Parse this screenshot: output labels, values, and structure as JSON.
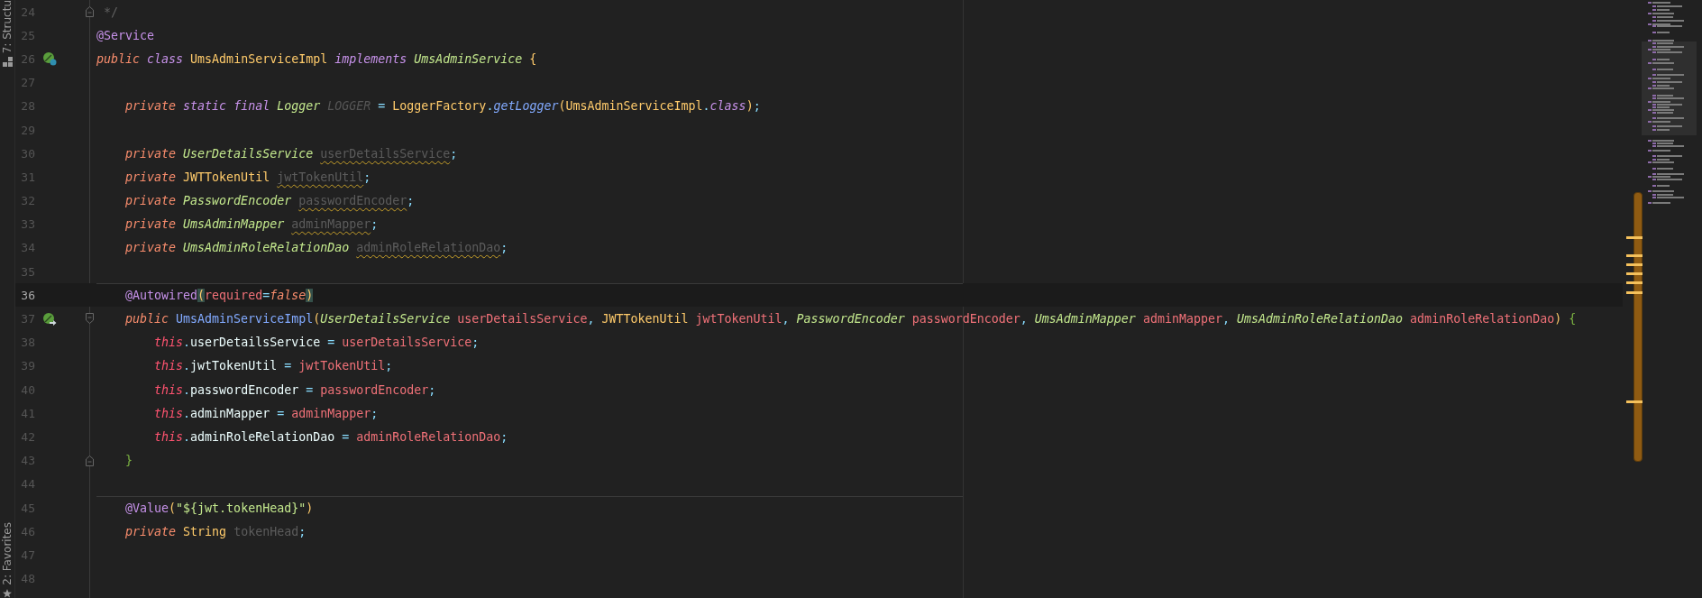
{
  "tool_windows_top": [
    {
      "label": "7: Structu"
    }
  ],
  "tool_windows_bottom": [
    {
      "label": "2: Favorites"
    }
  ],
  "editor": {
    "lines": [
      {
        "number": "24",
        "current": false,
        "separator": false,
        "fold": {
          "kind": "end"
        },
        "tokens": [
          {
            "text": " */",
            "kind": "comment"
          }
        ]
      },
      {
        "number": "25",
        "current": false,
        "separator": false,
        "tokens": [
          {
            "text": "@Service",
            "kind": "annot"
          }
        ]
      },
      {
        "number": "26",
        "current": false,
        "separator": false,
        "marker": {
          "kind": "bean-class"
        },
        "tokens": [
          {
            "text": "public ",
            "kind": "kw"
          },
          {
            "text": "class ",
            "kind": "kw2"
          },
          {
            "text": "UmsAdminServiceImpl ",
            "kind": "cls"
          },
          {
            "text": "implements ",
            "kind": "kw2"
          },
          {
            "text": "UmsAdminService ",
            "kind": "type"
          },
          {
            "text": "{",
            "kind": "paren"
          }
        ]
      },
      {
        "number": "27",
        "current": false,
        "separator": false
      },
      {
        "number": "28",
        "current": false,
        "separator": false,
        "tokens": [
          {
            "text": "    private ",
            "kind": "kw"
          },
          {
            "text": "static ",
            "kind": "kw2"
          },
          {
            "text": "final ",
            "kind": "kw2"
          },
          {
            "text": "Logger ",
            "kind": "type"
          },
          {
            "text": "LOGGER",
            "kind": "const-unused"
          },
          {
            "text": " = ",
            "kind": "punct"
          },
          {
            "text": "LoggerFactory",
            "kind": "cls"
          },
          {
            "text": ".",
            "kind": "punct"
          },
          {
            "text": "getLogger",
            "kind": "method"
          },
          {
            "text": "(",
            "kind": "paren"
          },
          {
            "text": "UmsAdminServiceImpl",
            "kind": "cls"
          },
          {
            "text": ".",
            "kind": "punct"
          },
          {
            "text": "class",
            "kind": "kw2"
          },
          {
            "text": ")",
            "kind": "paren"
          },
          {
            "text": ";",
            "kind": "punct"
          }
        ]
      },
      {
        "number": "29",
        "current": false,
        "separator": false
      },
      {
        "number": "30",
        "current": false,
        "separator": false,
        "tokens": [
          {
            "text": "    private ",
            "kind": "kw"
          },
          {
            "text": "UserDetailsService ",
            "kind": "type"
          },
          {
            "text": "userDetailsService",
            "kind": "unused-warn"
          },
          {
            "text": ";",
            "kind": "punct"
          }
        ]
      },
      {
        "number": "31",
        "current": false,
        "separator": false,
        "tokens": [
          {
            "text": "    private ",
            "kind": "kw"
          },
          {
            "text": "JWTTokenUtil ",
            "kind": "cls"
          },
          {
            "text": "jwtTokenUtil",
            "kind": "unused-warn"
          },
          {
            "text": ";",
            "kind": "punct"
          }
        ]
      },
      {
        "number": "32",
        "current": false,
        "separator": false,
        "tokens": [
          {
            "text": "    private ",
            "kind": "kw"
          },
          {
            "text": "PasswordEncoder ",
            "kind": "type"
          },
          {
            "text": "passwordEncoder",
            "kind": "unused-warn"
          },
          {
            "text": ";",
            "kind": "punct"
          }
        ]
      },
      {
        "number": "33",
        "current": false,
        "separator": false,
        "tokens": [
          {
            "text": "    private ",
            "kind": "kw"
          },
          {
            "text": "UmsAdminMapper ",
            "kind": "type"
          },
          {
            "text": "adminMapper",
            "kind": "unused-warn"
          },
          {
            "text": ";",
            "kind": "punct"
          }
        ]
      },
      {
        "number": "34",
        "current": false,
        "separator": false,
        "tokens": [
          {
            "text": "    private ",
            "kind": "kw"
          },
          {
            "text": "UmsAdminRoleRelationDao ",
            "kind": "type"
          },
          {
            "text": "adminRoleRelationDao",
            "kind": "unused-warn"
          },
          {
            "text": ";",
            "kind": "punct"
          }
        ]
      },
      {
        "number": "35",
        "current": false,
        "separator": false
      },
      {
        "number": "36",
        "current": true,
        "separator": true,
        "tokens": [
          {
            "text": "    @Autowired",
            "kind": "annot"
          },
          {
            "text": "(",
            "kind": "paren-match"
          },
          {
            "text": "required",
            "kind": "param"
          },
          {
            "text": "=",
            "kind": "punct"
          },
          {
            "text": "false",
            "kind": "kw"
          },
          {
            "text": ")",
            "kind": "paren-match"
          }
        ]
      },
      {
        "number": "37",
        "current": false,
        "separator": false,
        "fold": {
          "kind": "start"
        },
        "marker": {
          "kind": "bean-inject"
        },
        "tokens": [
          {
            "text": "    public ",
            "kind": "kw"
          },
          {
            "text": "UmsAdminServiceImpl",
            "kind": "ctor"
          },
          {
            "text": "(",
            "kind": "paren"
          },
          {
            "text": "UserDetailsService ",
            "kind": "type"
          },
          {
            "text": "userDetailsService",
            "kind": "param"
          },
          {
            "text": ", ",
            "kind": "punct"
          },
          {
            "text": "JWTTokenUtil ",
            "kind": "cls"
          },
          {
            "text": "jwtTokenUtil",
            "kind": "param"
          },
          {
            "text": ", ",
            "kind": "punct"
          },
          {
            "text": "PasswordEncoder ",
            "kind": "type"
          },
          {
            "text": "passwordEncoder",
            "kind": "param"
          },
          {
            "text": ", ",
            "kind": "punct"
          },
          {
            "text": "UmsAdminMapper ",
            "kind": "type"
          },
          {
            "text": "adminMapper",
            "kind": "param"
          },
          {
            "text": ", ",
            "kind": "punct"
          },
          {
            "text": "UmsAdminRoleRelationDao ",
            "kind": "type"
          },
          {
            "text": "adminRoleRelationDao",
            "kind": "param"
          },
          {
            "text": ") ",
            "kind": "paren"
          },
          {
            "text": "{",
            "kind": "brace"
          }
        ]
      },
      {
        "number": "38",
        "current": false,
        "separator": false,
        "tokens": [
          {
            "text": "        this",
            "kind": "this"
          },
          {
            "text": ".",
            "kind": "punct"
          },
          {
            "text": "userDetailsService",
            "kind": "field"
          },
          {
            "text": " = ",
            "kind": "punct"
          },
          {
            "text": "userDetailsService",
            "kind": "param"
          },
          {
            "text": ";",
            "kind": "punct"
          }
        ]
      },
      {
        "number": "39",
        "current": false,
        "separator": false,
        "tokens": [
          {
            "text": "        this",
            "kind": "this"
          },
          {
            "text": ".",
            "kind": "punct"
          },
          {
            "text": "jwtTokenUtil",
            "kind": "field"
          },
          {
            "text": " = ",
            "kind": "punct"
          },
          {
            "text": "jwtTokenUtil",
            "kind": "param"
          },
          {
            "text": ";",
            "kind": "punct"
          }
        ]
      },
      {
        "number": "40",
        "current": false,
        "separator": false,
        "tokens": [
          {
            "text": "        this",
            "kind": "this"
          },
          {
            "text": ".",
            "kind": "punct"
          },
          {
            "text": "passwordEncoder",
            "kind": "field"
          },
          {
            "text": " = ",
            "kind": "punct"
          },
          {
            "text": "passwordEncoder",
            "kind": "param"
          },
          {
            "text": ";",
            "kind": "punct"
          }
        ]
      },
      {
        "number": "41",
        "current": false,
        "separator": false,
        "tokens": [
          {
            "text": "        this",
            "kind": "this"
          },
          {
            "text": ".",
            "kind": "punct"
          },
          {
            "text": "adminMapper",
            "kind": "field"
          },
          {
            "text": " = ",
            "kind": "punct"
          },
          {
            "text": "adminMapper",
            "kind": "param"
          },
          {
            "text": ";",
            "kind": "punct"
          }
        ]
      },
      {
        "number": "42",
        "current": false,
        "separator": false,
        "tokens": [
          {
            "text": "        this",
            "kind": "this"
          },
          {
            "text": ".",
            "kind": "punct"
          },
          {
            "text": "adminRoleRelationDao",
            "kind": "field"
          },
          {
            "text": " = ",
            "kind": "punct"
          },
          {
            "text": "adminRoleRelationDao",
            "kind": "param"
          },
          {
            "text": ";",
            "kind": "punct"
          }
        ]
      },
      {
        "number": "43",
        "current": false,
        "separator": false,
        "fold": {
          "kind": "end"
        },
        "tokens": [
          {
            "text": "    }",
            "kind": "brace"
          }
        ]
      },
      {
        "number": "44",
        "current": false,
        "separator": false
      },
      {
        "number": "45",
        "current": false,
        "separator": true,
        "tokens": [
          {
            "text": "    @Value",
            "kind": "annot"
          },
          {
            "text": "(",
            "kind": "paren"
          },
          {
            "text": "\"${jwt.tokenHead}\"",
            "kind": "string"
          },
          {
            "text": ")",
            "kind": "paren"
          }
        ]
      },
      {
        "number": "46",
        "current": false,
        "separator": false,
        "tokens": [
          {
            "text": "    private ",
            "kind": "kw"
          },
          {
            "text": "String ",
            "kind": "cls"
          },
          {
            "text": "tokenHead",
            "kind": "unused"
          },
          {
            "text": ";",
            "kind": "punct"
          }
        ]
      },
      {
        "number": "47",
        "current": false,
        "separator": false
      },
      {
        "number": "48",
        "current": false,
        "separator": false
      }
    ]
  }
}
